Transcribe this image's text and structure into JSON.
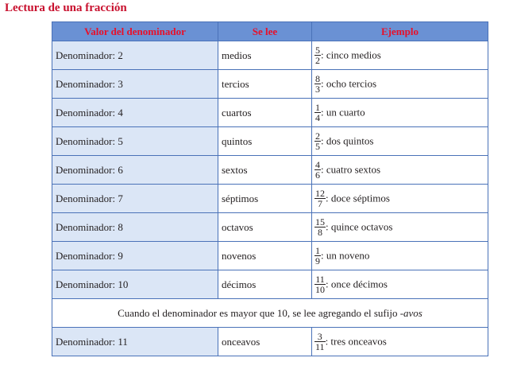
{
  "title": "Lectura de una fracción",
  "table": {
    "headers": [
      "Valor del denominador",
      "Se lee",
      "Ejemplo"
    ],
    "rows": [
      {
        "denominador": "Denominador: 2",
        "se_lee": "medios",
        "num": "5",
        "den": "2",
        "texto": ": cinco medios"
      },
      {
        "denominador": "Denominador: 3",
        "se_lee": "tercios",
        "num": "8",
        "den": "3",
        "texto": ": ocho tercios"
      },
      {
        "denominador": "Denominador: 4",
        "se_lee": "cuartos",
        "num": "1",
        "den": "4",
        "texto": ": un cuarto"
      },
      {
        "denominador": "Denominador: 5",
        "se_lee": "quintos",
        "num": "2",
        "den": "5",
        "texto": ": dos quintos"
      },
      {
        "denominador": "Denominador: 6",
        "se_lee": "sextos",
        "num": "4",
        "den": "6",
        "texto": ": cuatro sextos"
      },
      {
        "denominador": "Denominador: 7",
        "se_lee": "séptimos",
        "num": "12",
        "den": "7",
        "texto": ": doce séptimos"
      },
      {
        "denominador": "Denominador: 8",
        "se_lee": "octavos",
        "num": "15",
        "den": "8",
        "texto": ": quince octavos"
      },
      {
        "denominador": "Denominador: 9",
        "se_lee": "novenos",
        "num": "1",
        "den": "9",
        "texto": ": un noveno"
      },
      {
        "denominador": "Denominador: 10",
        "se_lee": "décimos",
        "num": "11",
        "den": "10",
        "texto": ": once décimos"
      }
    ],
    "note": {
      "text": "Cuando el denominador es mayor que 10, se lee agregando el sufijo ",
      "suffix": "-avos"
    },
    "last_row": {
      "denominador": "Denominador: 11",
      "se_lee": "onceavos",
      "num": "3",
      "den": "11",
      "texto": ": tres onceavos"
    }
  },
  "colors": {
    "title": "#c8102e",
    "header_bg": "#6a91d4",
    "header_text": "#e8102a",
    "first_col_bg": "#dbe6f6",
    "border": "#4a72b8"
  }
}
